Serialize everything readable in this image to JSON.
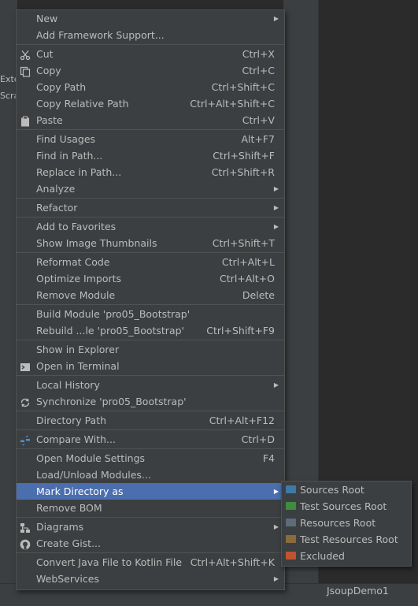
{
  "background": {
    "tree_fragments": [
      "Exte",
      "Scra"
    ],
    "editor_tab": "JsoupDemo1"
  },
  "colors": {
    "menu_bg": "#3c3f41",
    "selected_bg": "#4b6eaf",
    "text": "#bbbbbb",
    "sources_root": "#3c7aa8",
    "test_sources_root": "#3f8c3f",
    "resources_root": "#5e6b7b",
    "test_resources_root": "#8b6b3c",
    "excluded": "#c0542c"
  },
  "menu": {
    "items": [
      {
        "label": "New",
        "shortcut": "",
        "submenu": true,
        "icon": ""
      },
      {
        "label": "Add Framework Support...",
        "shortcut": "",
        "submenu": false,
        "icon": ""
      },
      {
        "label": "Cut",
        "shortcut": "Ctrl+X",
        "submenu": false,
        "icon": "scissors-icon"
      },
      {
        "label": "Copy",
        "shortcut": "Ctrl+C",
        "submenu": false,
        "icon": "copy-icon"
      },
      {
        "label": "Copy Path",
        "shortcut": "Ctrl+Shift+C",
        "submenu": false,
        "icon": ""
      },
      {
        "label": "Copy Relative Path",
        "shortcut": "Ctrl+Alt+Shift+C",
        "submenu": false,
        "icon": ""
      },
      {
        "label": "Paste",
        "shortcut": "Ctrl+V",
        "submenu": false,
        "icon": "paste-icon"
      },
      {
        "label": "Find Usages",
        "shortcut": "Alt+F7",
        "submenu": false,
        "icon": ""
      },
      {
        "label": "Find in Path...",
        "shortcut": "Ctrl+Shift+F",
        "submenu": false,
        "icon": ""
      },
      {
        "label": "Replace in Path...",
        "shortcut": "Ctrl+Shift+R",
        "submenu": false,
        "icon": ""
      },
      {
        "label": "Analyze",
        "shortcut": "",
        "submenu": true,
        "icon": ""
      },
      {
        "label": "Refactor",
        "shortcut": "",
        "submenu": true,
        "icon": ""
      },
      {
        "label": "Add to Favorites",
        "shortcut": "",
        "submenu": true,
        "icon": ""
      },
      {
        "label": "Show Image Thumbnails",
        "shortcut": "Ctrl+Shift+T",
        "submenu": false,
        "icon": ""
      },
      {
        "label": "Reformat Code",
        "shortcut": "Ctrl+Alt+L",
        "submenu": false,
        "icon": ""
      },
      {
        "label": "Optimize Imports",
        "shortcut": "Ctrl+Alt+O",
        "submenu": false,
        "icon": ""
      },
      {
        "label": "Remove Module",
        "shortcut": "Delete",
        "submenu": false,
        "icon": ""
      },
      {
        "label": "Build Module 'pro05_Bootstrap'",
        "shortcut": "",
        "submenu": false,
        "icon": ""
      },
      {
        "label": "Rebuild ...le 'pro05_Bootstrap'",
        "shortcut": "Ctrl+Shift+F9",
        "submenu": false,
        "icon": ""
      },
      {
        "label": "Show in Explorer",
        "shortcut": "",
        "submenu": false,
        "icon": ""
      },
      {
        "label": "Open in Terminal",
        "shortcut": "",
        "submenu": false,
        "icon": "terminal-icon"
      },
      {
        "label": "Local History",
        "shortcut": "",
        "submenu": true,
        "icon": ""
      },
      {
        "label": "Synchronize 'pro05_Bootstrap'",
        "shortcut": "",
        "submenu": false,
        "icon": "sync-icon"
      },
      {
        "label": "Directory Path",
        "shortcut": "Ctrl+Alt+F12",
        "submenu": false,
        "icon": ""
      },
      {
        "label": "Compare With...",
        "shortcut": "Ctrl+D",
        "submenu": false,
        "icon": "compare-icon"
      },
      {
        "label": "Open Module Settings",
        "shortcut": "F4",
        "submenu": false,
        "icon": ""
      },
      {
        "label": "Load/Unload Modules...",
        "shortcut": "",
        "submenu": false,
        "icon": ""
      },
      {
        "label": "Mark Directory as",
        "shortcut": "",
        "submenu": true,
        "icon": ""
      },
      {
        "label": "Remove BOM",
        "shortcut": "",
        "submenu": false,
        "icon": ""
      },
      {
        "label": "Diagrams",
        "shortcut": "",
        "submenu": true,
        "icon": "diagram-icon"
      },
      {
        "label": "Create Gist...",
        "shortcut": "",
        "submenu": false,
        "icon": "github-icon"
      },
      {
        "label": "Convert Java File to Kotlin File",
        "shortcut": "Ctrl+Alt+Shift+K",
        "submenu": false,
        "icon": ""
      },
      {
        "label": "WebServices",
        "shortcut": "",
        "submenu": true,
        "icon": ""
      }
    ]
  },
  "submenu": {
    "items": [
      {
        "label": "Sources Root",
        "color": "#3c7aa8"
      },
      {
        "label": "Test Sources Root",
        "color": "#3f8c3f"
      },
      {
        "label": "Resources Root",
        "color": "#5e6b7b"
      },
      {
        "label": "Test Resources Root",
        "color": "#8b6b3c"
      },
      {
        "label": "Excluded",
        "color": "#c0542c"
      }
    ]
  }
}
